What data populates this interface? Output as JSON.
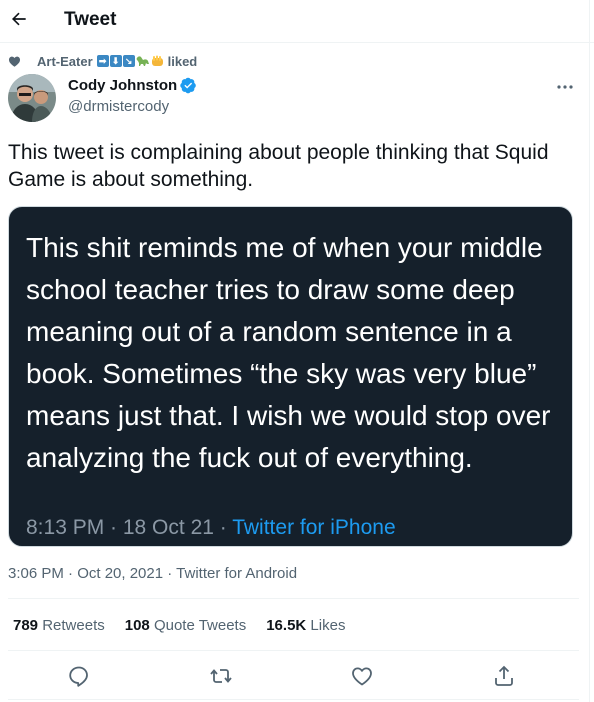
{
  "header": {
    "title": "Tweet",
    "back_icon": "arrow-left-icon"
  },
  "social_context": {
    "icon": "heart-icon",
    "user_name": "Art-Eater",
    "emojis": [
      "arrow-right-box-emoji",
      "arrow-down-box-emoji",
      "arrow-down-right-box-emoji",
      "sauropod-emoji",
      "raised-fist-emoji"
    ],
    "action": "liked"
  },
  "author": {
    "name": "Cody Johnston",
    "handle": "@drmistercody",
    "verified": true,
    "verified_color": "#1d9bf0"
  },
  "tweet": {
    "text": "This tweet is complaining about people thinking that Squid Game is about something.",
    "media": {
      "text": "This shit reminds me of when your middle school teacher tries to draw some deep meaning out of a random sentence in a book. Sometimes “the sky was very blue” means just that. I wish we would stop over analyzing the fuck out of everything.",
      "meta_time": "8:13 PM · 18 Oct 21 · ",
      "meta_source": "Twitter for iPhone",
      "background": "#15202b",
      "link_color": "#1d9bf0"
    },
    "time": "3:06 PM · Oct 20, 2021",
    "separator": " · ",
    "source": "Twitter for Android"
  },
  "stats": {
    "retweets": "789",
    "retweets_label": "Retweets",
    "quote_tweets": "108",
    "quote_tweets_label": "Quote Tweets",
    "likes": "16.5K",
    "likes_label": "Likes"
  },
  "actions": [
    "reply-icon",
    "retweet-icon",
    "like-icon",
    "share-icon"
  ]
}
